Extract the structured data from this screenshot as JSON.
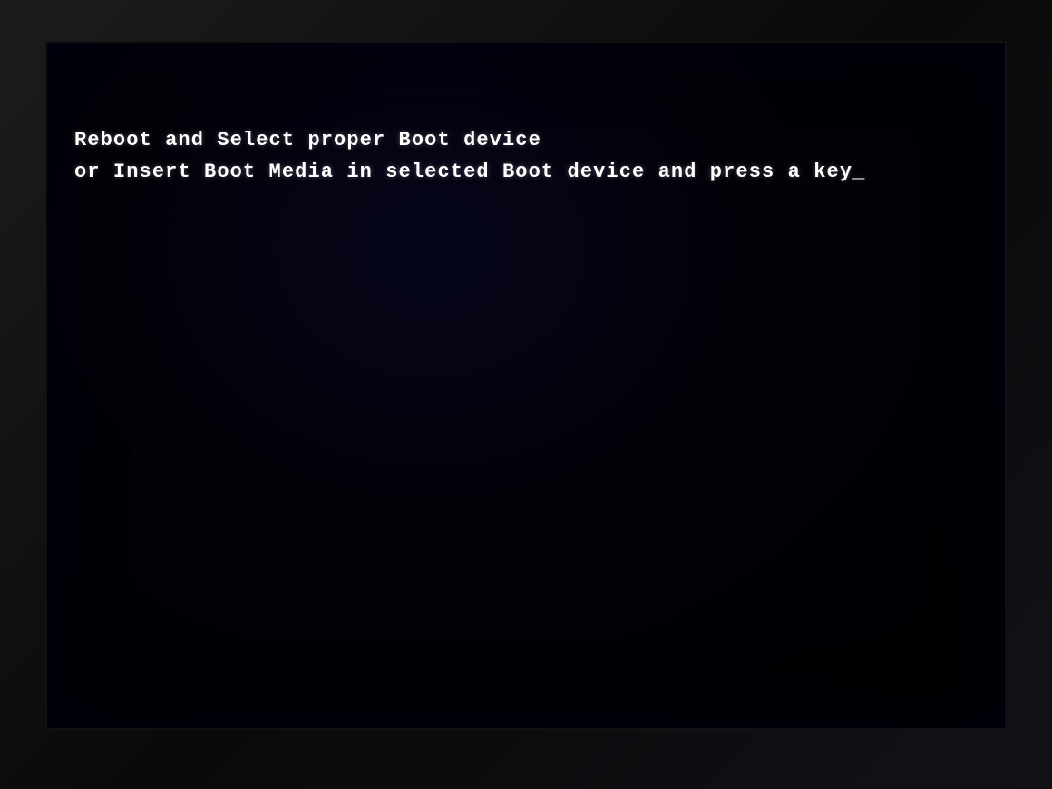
{
  "screen": {
    "background_color": "#000008",
    "bezel_color": "#111111"
  },
  "boot_message": {
    "line1": "Reboot and Select proper Boot device",
    "line2": "or Insert Boot Media in selected Boot device and press a key",
    "cursor": "_"
  }
}
